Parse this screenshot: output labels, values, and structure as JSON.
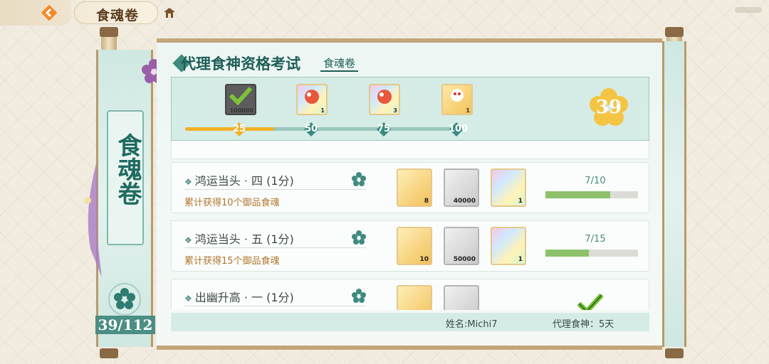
{
  "topbar": {
    "back_icon": "back-arrow-icon",
    "title": "食魂卷",
    "home_icon": "home-icon"
  },
  "sidebar": {
    "title": "食魂卷",
    "count": "39/112"
  },
  "header": {
    "title": "代理食神资格考试",
    "subtitle": "食魂卷"
  },
  "progress": {
    "current_score": "39",
    "fill_fraction": 0.33,
    "milestones": [
      {
        "label": "25",
        "reached": true
      },
      {
        "label": "50",
        "reached": false
      },
      {
        "label": "75",
        "reached": false
      },
      {
        "label": "100",
        "reached": false
      }
    ],
    "rewards": [
      {
        "type": "claimed",
        "qty": "100000"
      },
      {
        "type": "rainbow",
        "qty": "1"
      },
      {
        "type": "rainbow",
        "qty": "3"
      },
      {
        "type": "gold",
        "qty": "1"
      }
    ]
  },
  "tasks": [
    {
      "title": "鸿运当头 · 四 (1分)",
      "desc": "累计获得10个御品食魂",
      "items": [
        {
          "type": "gold",
          "qty": "8"
        },
        {
          "type": "silver",
          "qty": "40000"
        },
        {
          "type": "rainbow",
          "qty": "1"
        }
      ],
      "progress_text": "7/10",
      "progress_fraction": 0.7
    },
    {
      "title": "鸿运当头 · 五 (1分)",
      "desc": "累计获得15个御品食魂",
      "items": [
        {
          "type": "gold",
          "qty": "10"
        },
        {
          "type": "silver",
          "qty": "50000"
        },
        {
          "type": "rainbow",
          "qty": "1"
        }
      ],
      "progress_text": "7/15",
      "progress_fraction": 0.47
    },
    {
      "title": "出幽升高 · 一 (1分)",
      "desc": "",
      "items": [
        {
          "type": "gold",
          "qty": ""
        },
        {
          "type": "silver",
          "qty": ""
        }
      ],
      "completed": true
    }
  ],
  "footer": {
    "name": "姓名:Michi7",
    "days": "代理食神：5天"
  },
  "colors": {
    "accent": "#1e5e57",
    "progress": "#f0b028",
    "bar_fill": "#8dc26b",
    "desc": "#b0752c"
  }
}
